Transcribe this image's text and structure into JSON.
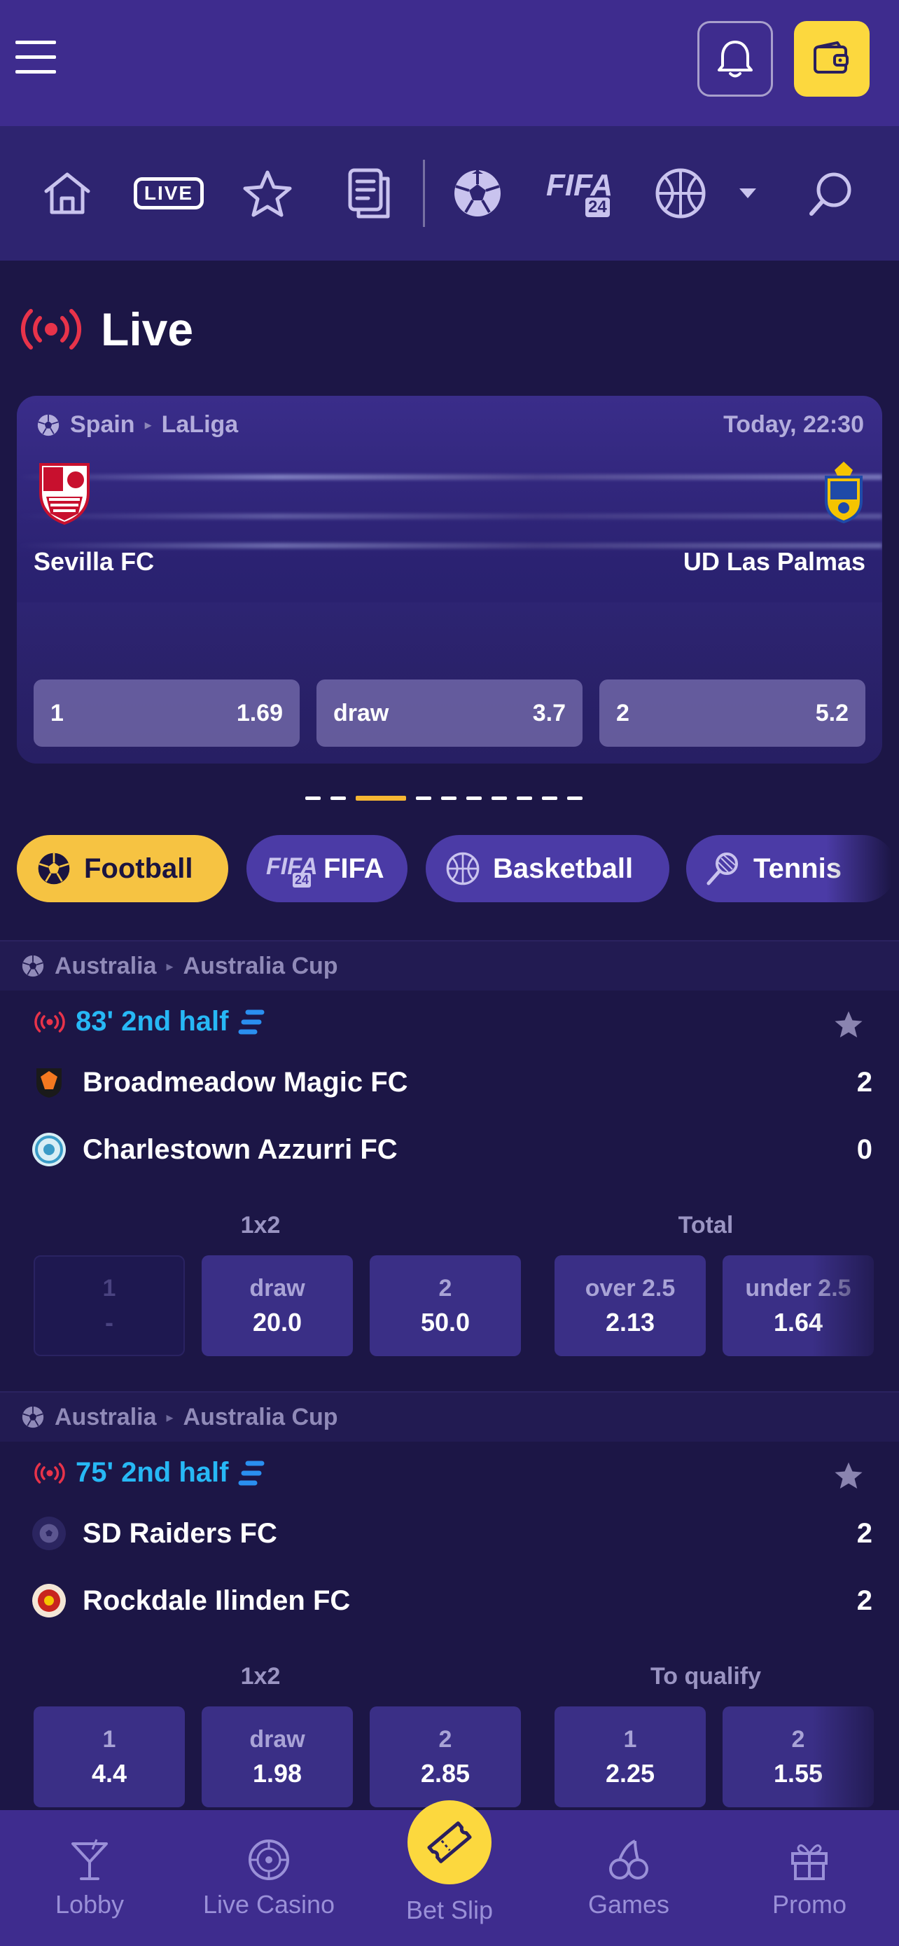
{
  "header": {
    "menu_icon": "hamburger-menu-icon",
    "bell_icon": "bell-icon",
    "wallet_icon": "wallet-icon"
  },
  "nav": {
    "live_label": "LIVE",
    "fifa_label": "FIFA",
    "fifa_badge": "24",
    "icons": [
      "home-icon",
      "live-icon",
      "star-icon",
      "betslip-history-icon",
      "football-icon",
      "fifa-icon",
      "basketball-icon",
      "chevron-down-icon",
      "search-icon"
    ]
  },
  "live_section": {
    "title": "Live"
  },
  "featured": {
    "country": "Spain",
    "league": "LaLiga",
    "time": "Today, 22:30",
    "home": "Sevilla FC",
    "away": "UD Las Palmas",
    "odds": [
      {
        "label": "1",
        "value": "1.69"
      },
      {
        "label": "draw",
        "value": "3.7"
      },
      {
        "label": "2",
        "value": "5.2"
      }
    ],
    "carousel_count": 10,
    "carousel_active": 3
  },
  "sports": [
    {
      "label": "Football",
      "badge": ""
    },
    {
      "label": "FIFA",
      "badge": "24"
    },
    {
      "label": "Basketball",
      "badge": ""
    },
    {
      "label": "Tennis",
      "badge": ""
    }
  ],
  "matches": [
    {
      "country": "Australia",
      "league": "Australia Cup",
      "status": "83' 2nd half",
      "home": {
        "name": "Broadmeadow Magic FC",
        "score": "2"
      },
      "away": {
        "name": "Charlestown Azzurri FC",
        "score": "0"
      },
      "market1": {
        "title": "1x2",
        "odds": [
          {
            "label": "1",
            "value": "-"
          },
          {
            "label": "draw",
            "value": "20.0"
          },
          {
            "label": "2",
            "value": "50.0"
          }
        ]
      },
      "market2": {
        "title": "Total",
        "odds": [
          {
            "label": "over 2.5",
            "value": "2.13"
          },
          {
            "label": "under 2.5",
            "value": "1.64"
          }
        ]
      }
    },
    {
      "country": "Australia",
      "league": "Australia Cup",
      "status": "75' 2nd half",
      "home": {
        "name": "SD Raiders FC",
        "score": "2"
      },
      "away": {
        "name": "Rockdale Ilinden FC",
        "score": "2"
      },
      "market1": {
        "title": "1x2",
        "odds": [
          {
            "label": "1",
            "value": "4.4"
          },
          {
            "label": "draw",
            "value": "1.98"
          },
          {
            "label": "2",
            "value": "2.85"
          }
        ]
      },
      "market2": {
        "title": "To qualify",
        "odds": [
          {
            "label": "1",
            "value": "2.25"
          },
          {
            "label": "2",
            "value": "1.55"
          }
        ]
      }
    }
  ],
  "bottom_nav": [
    {
      "label": "Lobby",
      "icon": "cocktail-icon"
    },
    {
      "label": "Live Casino",
      "icon": "roulette-icon"
    },
    {
      "label": "Bet Slip",
      "icon": "ticket-icon"
    },
    {
      "label": "Games",
      "icon": "cherries-icon"
    },
    {
      "label": "Promo",
      "icon": "gift-icon"
    }
  ],
  "colors": {
    "background": "#1c1646",
    "header": "#3e2c8e",
    "accent_yellow": "#fcd83e",
    "live_red": "#e8334a",
    "status_blue": "#27b8f5"
  }
}
